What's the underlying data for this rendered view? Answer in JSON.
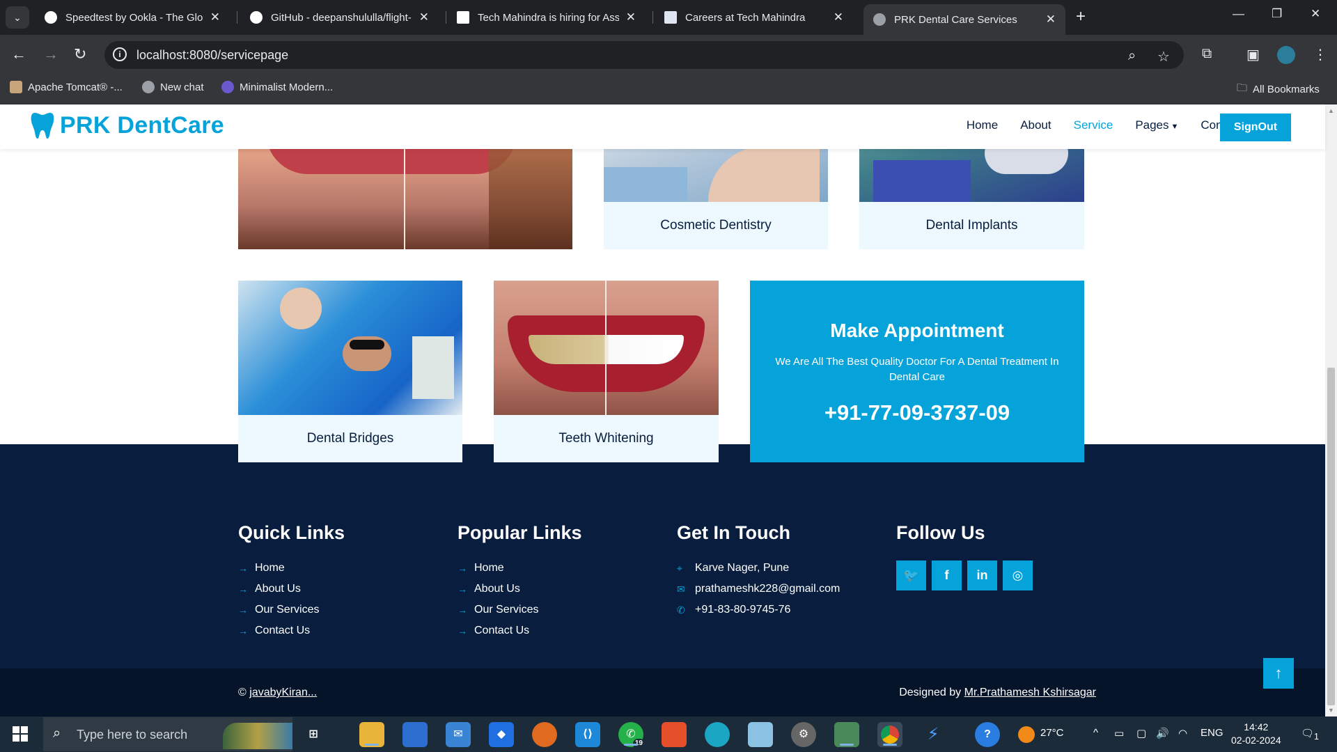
{
  "browser": {
    "tabs": [
      {
        "title": "Speedtest by Ookla - The Global Broadband Speed Test",
        "favicon": "speedtest-icon"
      },
      {
        "title": "GitHub - deepanshululla/flight-",
        "favicon": "github-icon"
      },
      {
        "title": "Tech Mahindra is hiring for Associate",
        "favicon": "gmail-icon"
      },
      {
        "title": "Careers at Tech Mahindra",
        "favicon": "doc-icon"
      },
      {
        "title": "PRK Dental Care Services",
        "favicon": "globe-icon",
        "active": true
      }
    ],
    "url": "localhost:8080/servicepage",
    "bookmarks": [
      {
        "label": "Apache Tomcat® -..."
      },
      {
        "label": "New chat"
      },
      {
        "label": "Minimalist Modern..."
      }
    ],
    "all_bookmarks": "All Bookmarks"
  },
  "site": {
    "brand": "PRK DentCare",
    "nav": [
      {
        "label": "Home"
      },
      {
        "label": "About"
      },
      {
        "label": "Service",
        "active": true
      },
      {
        "label": "Pages"
      },
      {
        "label": "Contact"
      }
    ],
    "signout": "SignOut",
    "services_row1": [
      "Cosmetic Dentistry",
      "Dental Implants"
    ],
    "services_row2": [
      "Dental Bridges",
      "Teeth Whitening"
    ],
    "appointment": {
      "title": "Make Appointment",
      "text": "We Are All The Best Quality Doctor For A Dental Treatment In Dental Care",
      "phone": "+91-77-09-3737-09"
    },
    "footer": {
      "quick_links": {
        "title": "Quick Links",
        "items": [
          "Home",
          "About Us",
          "Our Services",
          "Contact Us"
        ]
      },
      "popular_links": {
        "title": "Popular Links",
        "items": [
          "Home",
          "About Us",
          "Our Services",
          "Contact Us"
        ]
      },
      "contact": {
        "title": "Get In Touch",
        "address": "Karve Nager, Pune",
        "email": "prathameshk228@gmail.com",
        "phone": "+91-83-80-9745-76"
      },
      "follow": {
        "title": "Follow Us"
      },
      "copyright_prefix": "©",
      "copyright_link": "javabyKiran...",
      "designed_prefix": "Designed by",
      "designed_link": "Mr.Prathamesh Kshirsagar"
    },
    "accent_color": "#06A3DA",
    "dark_color": "#091E3E"
  },
  "taskbar": {
    "search_placeholder": "Type here to search",
    "whatsapp_badge": "19",
    "weather": "27°C",
    "language": "ENG",
    "time": "14:42",
    "date": "02-02-2024",
    "notification_count": "1"
  }
}
